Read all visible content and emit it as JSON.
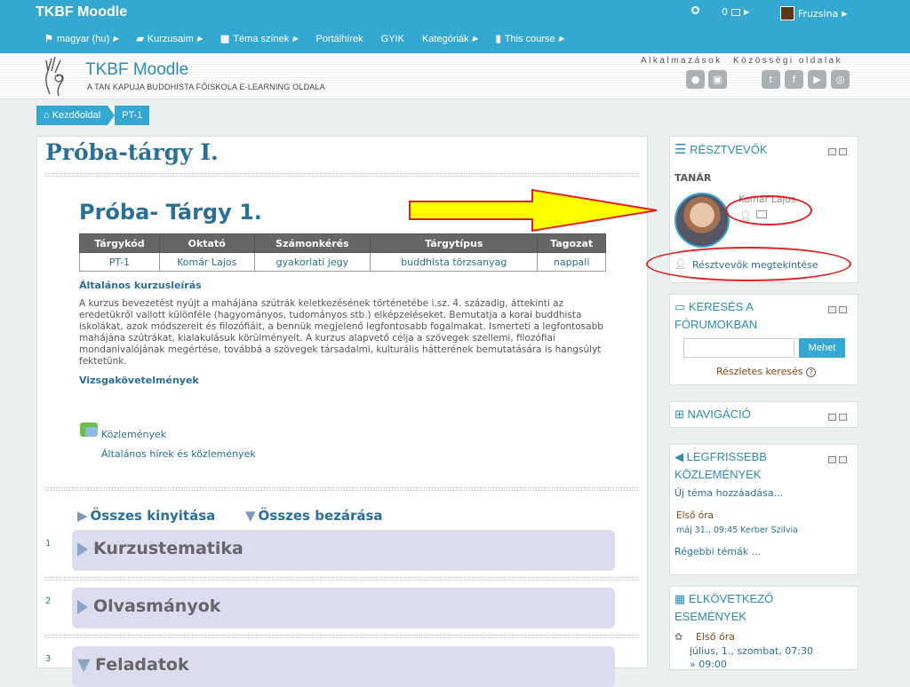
{
  "topbar": {
    "brand": "TKBF Moodle",
    "messages_count": "0",
    "user_name": "Fruzsina",
    "nav": [
      "magyar (hu)",
      "Kurzusaim",
      "Téma színek",
      "Portálhírek",
      "GYIK",
      "Kategóriák",
      "This course"
    ]
  },
  "header": {
    "site_name": "TKBF Moodle",
    "site_sub": "A TAN KAPUJA BUDDHISTA FŐISKOLA E-LEARNING OLDALA",
    "apps_label": "Alkalmazások",
    "social_label": "Közösségi oldalak"
  },
  "breadcrumb": [
    "Kezdőoldal",
    "PT-1"
  ],
  "main": {
    "title": "Próba-tárgy I.",
    "course_title": "Próba- Tárgy 1.",
    "table": {
      "headers": [
        "Tárgykód",
        "Oktató",
        "Számonkérés",
        "Tárgytípus",
        "Tagozat"
      ],
      "row": [
        "PT-1",
        "Komár Lajos",
        "gyakorlati jegy",
        "buddhista törzsanyag",
        "nappali"
      ]
    },
    "desc_heading": "Általános kurzusleírás",
    "desc_text": "A kurzus bevezetést nyújt a mahájána szútrák keletkezésének történetébe i.sz. 4. századig, áttekinti az eredetükről vallott különféle (hagyományos, tudományos stb.) elképzeléseket. Bemutatja a korai buddhista iskolákat, azok módszereit és filozófiáit, a bennük megjelenő legfontosabb fogalmakat. Ismerteti a legfontosabb mahájána szútrákat, kialakulásuk körülményeit. A kurzus alapvető célja a szövegek szellemi, filozófiai mondanivalójának megértése, továbbá a szövegek társadalmi, kulturális hátterének bemutatására is hangsúlyt fektetünk.",
    "req_heading": "Vizsgakövetelmények",
    "forum_link": "Közlemények",
    "forum_sub": "Általános hírek és közlemények",
    "expand_all": "Összes kinyitása",
    "collapse_all": "Összes bezárása",
    "sections": [
      {
        "num": "1",
        "title": "Kurzustematika"
      },
      {
        "num": "2",
        "title": "Olvasmányok"
      },
      {
        "num": "3",
        "title": "Feladatok"
      }
    ]
  },
  "blocks": {
    "participants": {
      "title": "RÉSZTVEVŐK",
      "role": "TANÁR",
      "teacher": "Komár Lajos",
      "view_link": "Résztvevők megtekintése"
    },
    "search": {
      "title": "KERESÉS A FÓRUMOKBAN",
      "title_l1": "KERESÉS A",
      "title_l2": "FÓRUMOKBAN",
      "button": "Mehet",
      "advanced": "Részletes keresés"
    },
    "navigation": {
      "title": "NAVIGÁCIÓ"
    },
    "news": {
      "title_l1": "LEGFRISSEBB",
      "title_l2": "KÖZLEMÉNYEK",
      "add_topic": "Új téma hozzáadása...",
      "item_title": "Első óra",
      "item_meta": "máj 31., 09:45",
      "item_author": "Kerber Szilvia",
      "older": "Régebbi témák ..."
    },
    "events": {
      "title_l1": "ELKÖVETKEZŐ",
      "title_l2": "ESEMÉNYEK",
      "item_title": "Első óra",
      "item_date": "július, 1., szombat, 07:30",
      "item_time": "» 09:00"
    }
  },
  "colors": {
    "brand": "#34a8d0",
    "link": "#2b6f96",
    "annotation": "#e02020",
    "arrow": "#ffff00"
  }
}
